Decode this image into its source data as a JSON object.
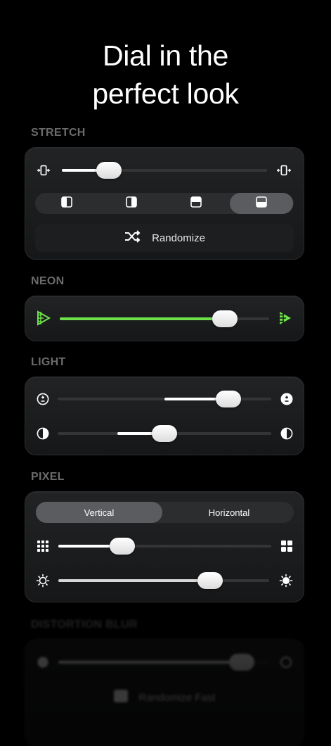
{
  "headline": "Dial in the perfect look",
  "headline_line1": "Dial in the",
  "headline_line2": "perfect look",
  "sections": {
    "stretch": {
      "label": "STRETCH",
      "slider_value": 0.23,
      "modes": [
        "split-left",
        "split-right",
        "split-top",
        "split-bottom"
      ],
      "active_mode": 3,
      "randomize_label": "Randomize"
    },
    "neon": {
      "label": "NEON",
      "slider_value": 0.79,
      "accent": "#6fe24a"
    },
    "light": {
      "label": "LIGHT",
      "exposure_value": 0.8,
      "contrast_value": 0.5
    },
    "pixel": {
      "label": "PIXEL",
      "tabs": [
        "Vertical",
        "Horizontal"
      ],
      "active_tab": 0,
      "grid_value": 0.3,
      "brightness_value": 0.72
    },
    "distortion": {
      "label": "DISTORTION BLUR",
      "slider_value": 0.87,
      "randomize_label": "Randomize Fast"
    }
  },
  "colors": {
    "background": "#000000",
    "card": "#1c1d1f",
    "label": "#6b6b6b",
    "neon": "#6fe24a"
  }
}
